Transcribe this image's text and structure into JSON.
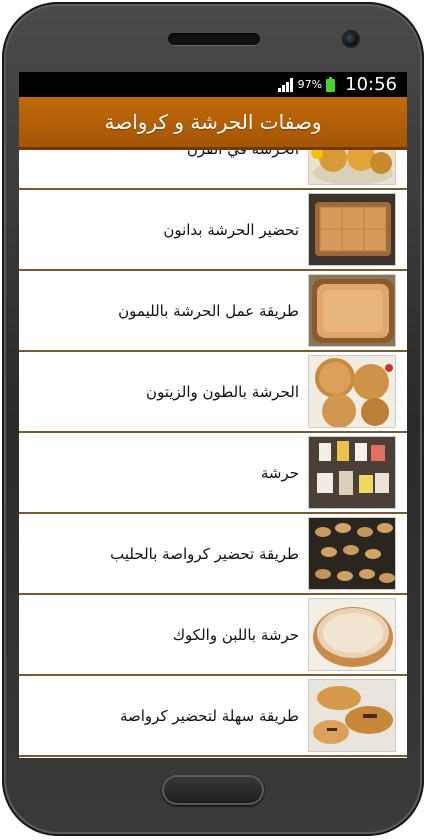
{
  "status_bar": {
    "battery_percent": "97%",
    "time": "10:56",
    "battery_color": "#44d62c"
  },
  "app_bar": {
    "title": "وصفات الحرشة و كرواصة",
    "color": "#b05e07"
  },
  "list": {
    "items": [
      {
        "label": "الحرشة في الفرن",
        "icon": "harcha-cakes-thumbnail"
      },
      {
        "label": "تحضير الحرشة بدانون",
        "icon": "harcha-tray-thumbnail"
      },
      {
        "label": "طريقة عمل الحرشة بالليمون",
        "icon": "lemon-harcha-tray-thumbnail"
      },
      {
        "label": "الحرشة بالطون والزيتون",
        "icon": "tuna-olive-harcha-thumbnail"
      },
      {
        "label": "حرشة",
        "icon": "harcha-ingredients-thumbnail"
      },
      {
        "label": "طريقة تحضير كرواصة بالحليب",
        "icon": "milk-croissant-thumbnail"
      },
      {
        "label": "حرشة باللبن والكوك",
        "icon": "coconut-harcha-thumbnail"
      },
      {
        "label": "طريقة سهلة لتحضير كرواصة",
        "icon": "easy-croissant-thumbnail"
      }
    ]
  }
}
